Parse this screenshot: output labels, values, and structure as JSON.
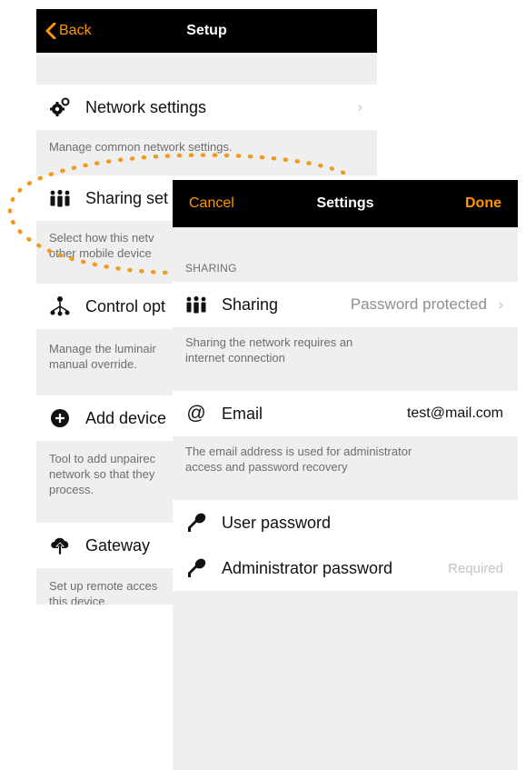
{
  "setup_screen": {
    "nav": {
      "back_label": "Back",
      "title": "Setup"
    },
    "items": [
      {
        "label": "Network settings",
        "icon": "gears-icon",
        "description": "Manage common network settings."
      },
      {
        "label": "Sharing set",
        "icon": "people-icon",
        "description_lines": [
          "Select how this netv",
          "other mobile device"
        ]
      },
      {
        "label": "Control opt",
        "icon": "hierarchy-icon",
        "description_lines": [
          "Manage the luminair",
          "manual override."
        ]
      },
      {
        "label": "Add device",
        "icon": "plus-circle-icon",
        "description_lines": [
          "Tool to add unpairec",
          "network so that they",
          "process."
        ]
      },
      {
        "label": "Gateway",
        "icon": "cloud-upload-icon",
        "description_lines": [
          "Set up remote acces",
          "this device."
        ]
      }
    ]
  },
  "settings_screen": {
    "nav": {
      "cancel_label": "Cancel",
      "title": "Settings",
      "done_label": "Done"
    },
    "section_header": "SHARING",
    "sharing": {
      "label": "Sharing",
      "value": "Password protected",
      "description_lines": [
        "Sharing the network requires an",
        "internet connection"
      ]
    },
    "email": {
      "label": "Email",
      "value": "test@mail.com",
      "description_lines": [
        "The email address is used for administrator",
        "access and password recovery"
      ]
    },
    "user_password": {
      "label": "User password"
    },
    "admin_password": {
      "label": "Administrator password",
      "placeholder": "Required"
    }
  },
  "colors": {
    "accent": "#ff9500",
    "highlight_dots": "#f29a1e",
    "navbar": "#000000",
    "background": "#efefef"
  }
}
